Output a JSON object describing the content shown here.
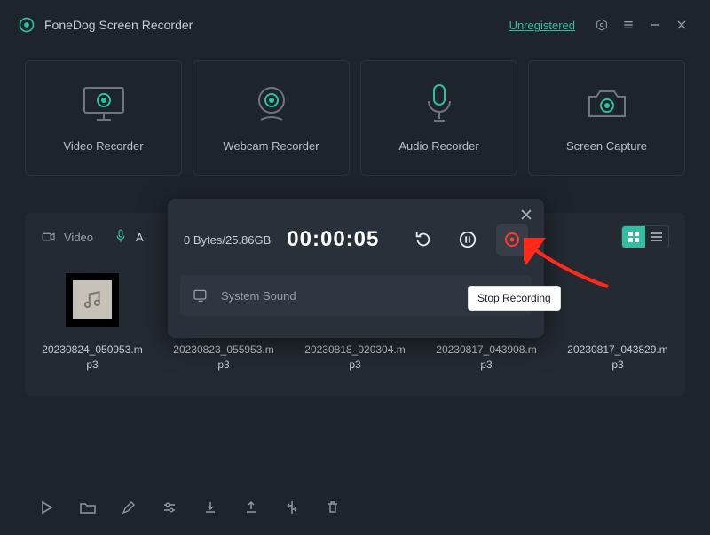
{
  "app": {
    "title": "FoneDog Screen Recorder"
  },
  "titlebar": {
    "registration": "Unregistered"
  },
  "modes": {
    "video": {
      "label": "Video Recorder"
    },
    "webcam": {
      "label": "Webcam Recorder"
    },
    "audio": {
      "label": "Audio Recorder"
    },
    "screen": {
      "label": "Screen Capture"
    }
  },
  "tabs": {
    "video": "Video",
    "audio_initial": "A"
  },
  "recordings": [
    {
      "name": "20230824_050953.mp3"
    },
    {
      "name": "20230823_055953.mp3"
    },
    {
      "name": "20230818_020304.mp3"
    },
    {
      "name": "20230817_043908.mp3"
    },
    {
      "name": "20230817_043829.mp3"
    }
  ],
  "popup": {
    "bytes": "0 Bytes/25.86GB",
    "timer": "00:00:05",
    "source_label": "System Sound",
    "tooltip": "Stop Recording"
  },
  "colors": {
    "accent": "#2fbfa0",
    "danger": "#ff3b30",
    "bg": "#1e242c",
    "panel": "#2a3039"
  }
}
